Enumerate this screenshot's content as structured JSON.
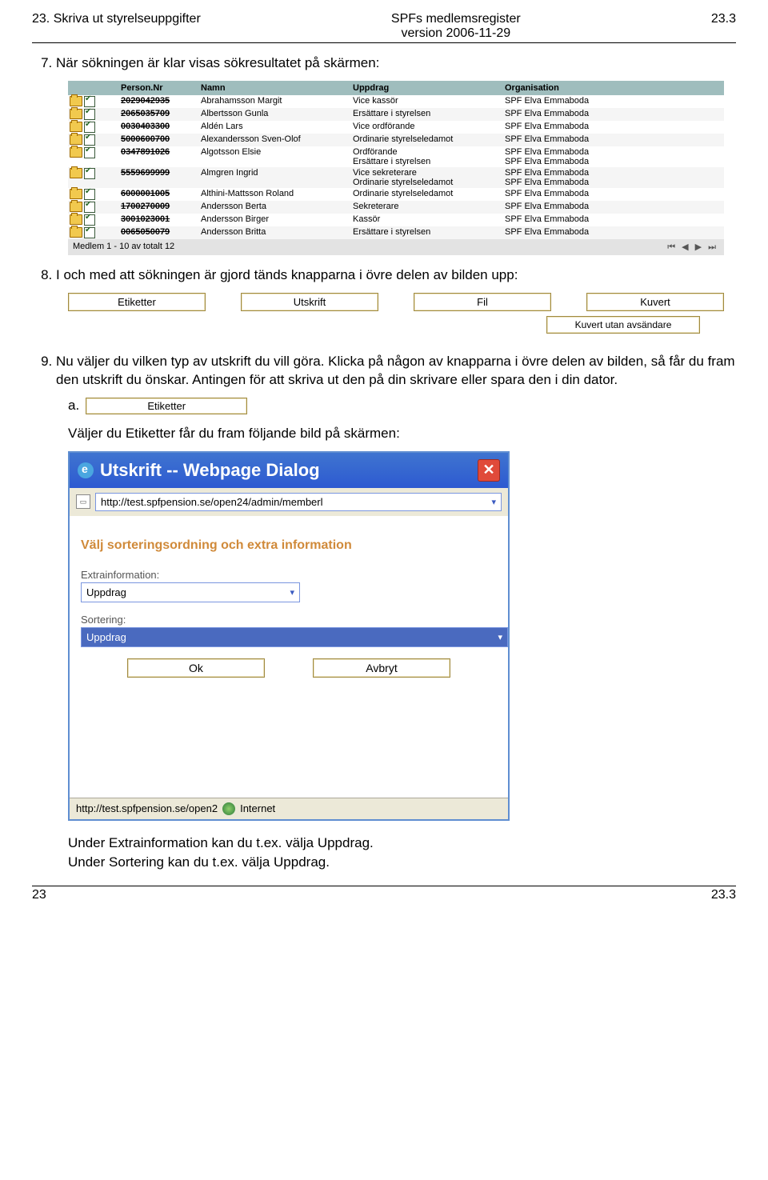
{
  "header": {
    "left": "23. Skriva ut styrelseuppgifter",
    "mid1": "SPFs medlemsregister",
    "mid2": "version 2006-11-29",
    "right": "23.3"
  },
  "steps": {
    "s7": "När sökningen är klar visas sökresultatet på skärmen:",
    "s8": "I och med att sökningen är gjord tänds knapparna i övre delen av bilden upp:",
    "s9": "Nu väljer du vilken typ av utskrift du vill göra. Klicka på någon av knapparna i övre delen av bilden, så får du fram den utskrift du önskar. Antingen för att skriva ut den på din skrivare eller spara den i din dator."
  },
  "table": {
    "headers": {
      "pn": "Person.Nr",
      "nm": "Namn",
      "up": "Uppdrag",
      "org": "Organisation"
    },
    "rows": [
      {
        "pn": "2029042935",
        "nm": "Abrahamsson Margit",
        "up": [
          "Vice kassör"
        ],
        "org": "SPF Elva Emmaboda"
      },
      {
        "pn": "2065035709",
        "nm": "Albertsson Gunla",
        "up": [
          "Ersättare i styrelsen"
        ],
        "org": "SPF Elva Emmaboda"
      },
      {
        "pn": "0030403300",
        "nm": "Aldén Lars",
        "up": [
          "Vice ordförande"
        ],
        "org": "SPF Elva Emmaboda"
      },
      {
        "pn": "5000600700",
        "nm": "Alexandersson Sven-Olof",
        "up": [
          "Ordinarie styrelseledamot"
        ],
        "org": "SPF Elva Emmaboda"
      },
      {
        "pn": "0347891026",
        "nm": "Algotsson Elsie",
        "up": [
          "Ordförande",
          "Ersättare i styrelsen"
        ],
        "org": "SPF Elva Emmaboda"
      },
      {
        "pn": "5559699999",
        "nm": "Almgren Ingrid",
        "up": [
          "Vice sekreterare",
          "Ordinarie styrelseledamot"
        ],
        "org": "SPF Elva Emmaboda"
      },
      {
        "pn": "6000001005",
        "nm": "Althini-Mattsson Roland",
        "up": [
          "Ordinarie styrelseledamot"
        ],
        "org": "SPF Elva Emmaboda"
      },
      {
        "pn": "1700270009",
        "nm": "Andersson Berta",
        "up": [
          "Sekreterare"
        ],
        "org": "SPF Elva Emmaboda"
      },
      {
        "pn": "3001023001",
        "nm": "Andersson Birger",
        "up": [
          "Kassör"
        ],
        "org": "SPF Elva Emmaboda"
      },
      {
        "pn": "0065050079",
        "nm": "Andersson Britta",
        "up": [
          "Ersättare i styrelsen"
        ],
        "org": "SPF Elva Emmaboda"
      }
    ],
    "footer": "Medlem 1 - 10 av totalt 12"
  },
  "buttons": {
    "b1": "Etiketter",
    "b2": "Utskrift",
    "b3": "Fil",
    "b4": "Kuvert",
    "b5": "Kuvert utan avsändare"
  },
  "sub_a_letter": "a.",
  "sub_a_text": "Väljer du Etiketter får du fram följande bild på skärmen:",
  "dialog": {
    "title": "Utskrift -- Webpage Dialog",
    "url": "http://test.spfpension.se/open24/admin/memberl",
    "heading": "Välj sorteringsordning och extra information",
    "lbl_extra": "Extrainformation:",
    "val_extra": "Uppdrag",
    "lbl_sort": "Sortering:",
    "val_sort": "Uppdrag",
    "ok": "Ok",
    "cancel": "Avbryt",
    "status_url": "http://test.spfpension.se/open2",
    "status_zone": "Internet"
  },
  "under": {
    "l1": "Under Extrainformation kan du t.ex. välja Uppdrag.",
    "l2": "Under Sortering kan du t.ex. välja Uppdrag."
  },
  "footer": {
    "left": "23",
    "right": "23.3"
  }
}
